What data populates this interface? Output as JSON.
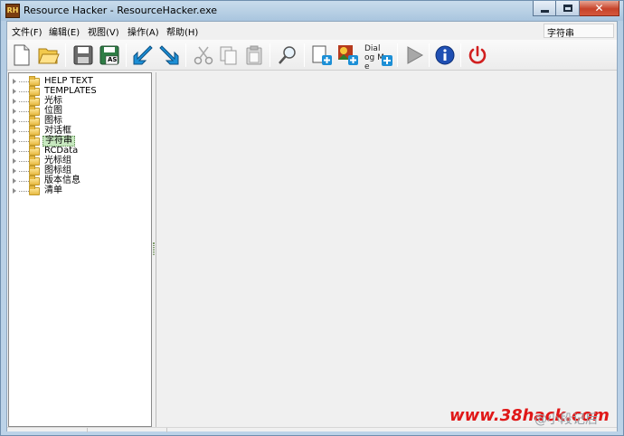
{
  "window": {
    "icon_text": "RH",
    "title": "Resource Hacker - ResourceHacker.exe"
  },
  "menu": {
    "items": [
      {
        "label": "文件(F)"
      },
      {
        "label": "编辑(E)"
      },
      {
        "label": "视图(V)"
      },
      {
        "label": "操作(A)"
      },
      {
        "label": "帮助(H)"
      }
    ],
    "current_item": "字符串"
  },
  "toolbar": {
    "buttons": [
      {
        "name": "new-file-icon"
      },
      {
        "name": "open-folder-icon"
      },
      {
        "name": "save-icon"
      },
      {
        "name": "save-as-icon",
        "label": "AS"
      },
      {
        "name": "compile-arrow-icon"
      },
      {
        "name": "edit-arrow-icon"
      },
      {
        "name": "cut-icon"
      },
      {
        "name": "copy-icon"
      },
      {
        "name": "paste-icon"
      },
      {
        "name": "find-icon"
      },
      {
        "name": "add-resource-icon"
      },
      {
        "name": "add-image-icon"
      },
      {
        "name": "dialog-merge-icon",
        "label": "Dialog Me"
      },
      {
        "name": "play-icon"
      },
      {
        "name": "info-icon"
      },
      {
        "name": "power-icon"
      }
    ]
  },
  "tree": {
    "items": [
      {
        "label": "HELP TEXT"
      },
      {
        "label": "TEMPLATES"
      },
      {
        "label": "光标"
      },
      {
        "label": "位图"
      },
      {
        "label": "图标"
      },
      {
        "label": "对话框"
      },
      {
        "label": "字符串",
        "selected": true
      },
      {
        "label": "RCData"
      },
      {
        "label": "光标组"
      },
      {
        "label": "图标组"
      },
      {
        "label": "版本信息"
      },
      {
        "label": "清单"
      }
    ]
  },
  "watermark": {
    "site": "www.38hack.com",
    "tag": "@小段记后"
  },
  "colors": {
    "selection": "#c7e8bf",
    "close_button": "#c7432a",
    "watermark": "#e01818"
  }
}
